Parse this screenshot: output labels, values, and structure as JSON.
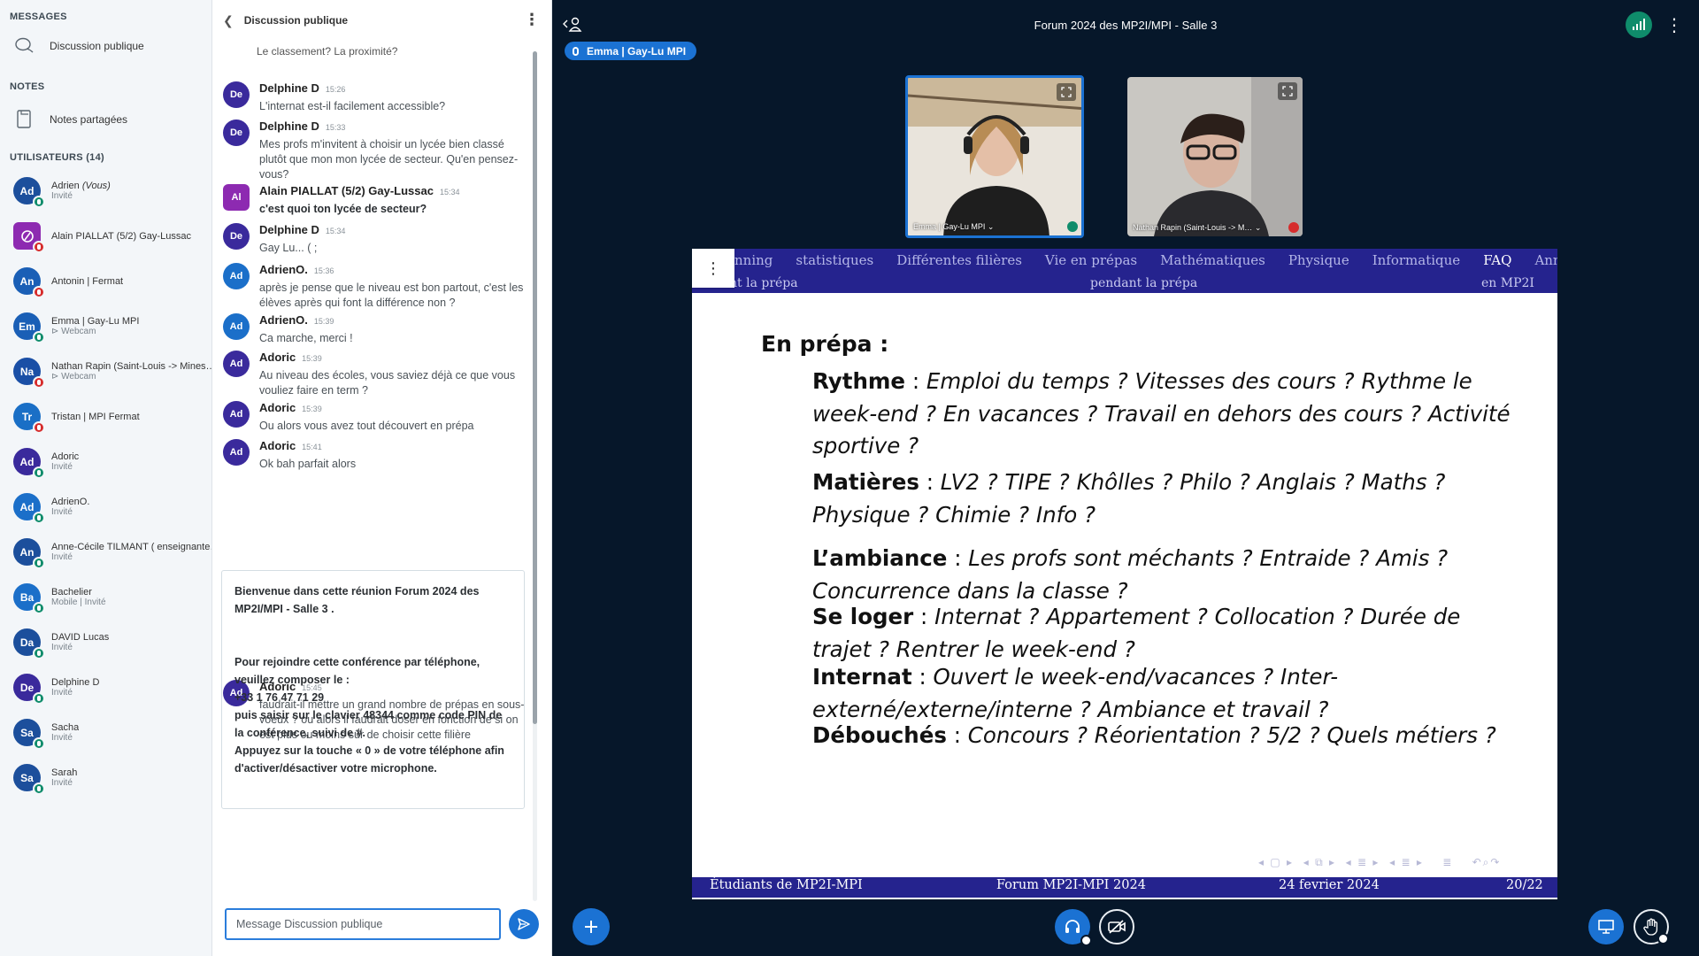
{
  "sidebar": {
    "messages_title": "MESSAGES",
    "public_chat": "Discussion publique",
    "notes_title": "NOTES",
    "shared_notes": "Notes partagées",
    "users_title": "UTILISATEURS (14)",
    "users": [
      {
        "initials": "Ad",
        "name": "Adrien",
        "you": "(Vous)",
        "sub": "Invité",
        "color": "#1c4f9c",
        "status": "green"
      },
      {
        "initials": "",
        "name": "Alain PIALLAT (5/2) Gay-Lussac",
        "you": "",
        "sub": "",
        "color": "#8d2ab1",
        "status": "red"
      },
      {
        "initials": "An",
        "name": "Antonin | Fermat",
        "you": "",
        "sub": "",
        "color": "#1a5fb6",
        "status": "red"
      },
      {
        "initials": "Em",
        "name": "Emma | Gay-Lu MPI",
        "you": "",
        "sub": "⊳ Webcam",
        "color": "#1a5fb6",
        "status": "green"
      },
      {
        "initials": "Na",
        "name": "Nathan Rapin (Saint-Louis -> Mines…",
        "you": "",
        "sub": "⊳ Webcam",
        "color": "#1a4fa6",
        "status": "red"
      },
      {
        "initials": "Tr",
        "name": "Tristan | MPI Fermat",
        "you": "",
        "sub": "",
        "color": "#1a6fc6",
        "status": "red"
      },
      {
        "initials": "Ad",
        "name": "Adoric",
        "you": "",
        "sub": "Invité",
        "color": "#3a2a9c",
        "status": "green"
      },
      {
        "initials": "Ad",
        "name": "AdrienO.",
        "you": "",
        "sub": "Invité",
        "color": "#1b6fc9",
        "status": "green"
      },
      {
        "initials": "An",
        "name": "Anne-Cécile TILMANT ( enseignante…",
        "you": "",
        "sub": "Invité",
        "color": "#1c4f9c",
        "status": "green"
      },
      {
        "initials": "Ba",
        "name": "Bachelier",
        "you": "",
        "sub": "Mobile | Invité",
        "color": "#1b6fc9",
        "status": "green"
      },
      {
        "initials": "Da",
        "name": "DAVID Lucas",
        "you": "",
        "sub": "Invité",
        "color": "#1c4f9c",
        "status": "green"
      },
      {
        "initials": "De",
        "name": "Delphine D",
        "you": "",
        "sub": "Invité",
        "color": "#3a2a9c",
        "status": "green"
      },
      {
        "initials": "Sa",
        "name": "Sacha",
        "you": "",
        "sub": "Invité",
        "color": "#1c4f9c",
        "status": "green"
      },
      {
        "initials": "Sa",
        "name": "Sarah",
        "you": "",
        "sub": "Invité",
        "color": "#1c4f9c",
        "status": "green"
      }
    ]
  },
  "chat": {
    "title": "Discussion publique",
    "truncated_top": "Comment choisir au mieux son établissement selon vous? Le classement? La proximité?",
    "messages": [
      {
        "initials": "De",
        "color": "#3a2a9c",
        "author": "Delphine D",
        "time": "15:26",
        "text": "L'internat est-il facilement accessible?",
        "bold": false
      },
      {
        "initials": "De",
        "color": "#3a2a9c",
        "author": "Delphine D",
        "time": "15:33",
        "text": "Mes profs m'invitent à choisir un lycée bien classé plutôt que mon mon lycée de secteur. Qu'en pensez-vous?",
        "bold": false
      },
      {
        "initials": "Al",
        "color": "#8d2ab1",
        "author": "Alain PIALLAT (5/2) Gay-Lussac",
        "time": "15:34",
        "text": "c'est quoi ton lycée de secteur?",
        "bold": true
      },
      {
        "initials": "De",
        "color": "#3a2a9c",
        "author": "Delphine D",
        "time": "15:34",
        "text": "Gay Lu... ( ;",
        "bold": false
      },
      {
        "initials": "Ad",
        "color": "#1b6fc9",
        "author": "AdrienO.",
        "time": "15:36",
        "text": "après je pense que le niveau est bon partout, c'est les élèves après qui font la différence non ?",
        "bold": false
      },
      {
        "initials": "Ad",
        "color": "#1b6fc9",
        "author": "AdrienO.",
        "time": "15:39",
        "text": "Ca marche, merci !",
        "bold": false
      },
      {
        "initials": "Ad",
        "color": "#3a2a9c",
        "author": "Adoric",
        "time": "15:39",
        "text": "Au niveau des écoles, vous saviez déjà ce que vous vouliez faire en term ?",
        "bold": false
      },
      {
        "initials": "Ad",
        "color": "#3a2a9c",
        "author": "Adoric",
        "time": "15:39",
        "text": "Ou alors vous avez tout découvert en prépa",
        "bold": false
      },
      {
        "initials": "Ad",
        "color": "#3a2a9c",
        "author": "Adoric",
        "time": "15:41",
        "text": "Ok bah parfait alors",
        "bold": false
      },
      {
        "initials": "Ad",
        "color": "#3a2a9c",
        "author": "Adoric",
        "time": "15:45",
        "text": "faudrait-il mettre un grand nombre de prépas en sous-voeux ? ou alors il faudrait doser en fonction de si on est plus ou moins sûr de choisir cette filière",
        "bold": false
      }
    ],
    "welcome": {
      "line1": "Bienvenue dans cette réunion Forum 2024 des MP2I/MPI - Salle 3 .",
      "line2": "Pour rejoindre cette conférence par téléphone, veuillez composer le :",
      "phone": "+33 1 76 47 71 29",
      "line3": "puis saisir sur le clavier 48344 comme code PIN de la conférence, suivi de #.",
      "line4": "Appuyez sur la touche « 0 » de votre téléphone afin d'activer/désactiver votre microphone."
    },
    "input_placeholder": "Message Discussion publique"
  },
  "meeting": {
    "title": "Forum 2024 des MP2I/MPI - Salle 3",
    "talking": "Emma | Gay-Lu MPI",
    "videos": [
      {
        "label": "Emma | Gay-Lu MPI ⌄"
      },
      {
        "label": "Nathan Rapin (Saint-Louis -> M… ⌄"
      }
    ]
  },
  "slide": {
    "nav_top": [
      "nning",
      "statistiques",
      "Différentes filières",
      "Vie en prépas",
      "Mathématiques",
      "Physique",
      "Informatique",
      "FAQ",
      "Annexe"
    ],
    "nav_active": "FAQ",
    "nav_sub_left": "nt la prépa",
    "nav_sub_center": "pendant la prépa",
    "nav_sub_right": "en MP2I",
    "heading": "En prépa :",
    "items": [
      {
        "term": "Rythme",
        "text": "Emploi du temps ? Vitesses des cours ? Rythme le week-end ? En vacances ? Travail en dehors des cours ? Activité sportive ?"
      },
      {
        "term": "Matières",
        "text": "LV2 ? TIPE ? Khôlles ? Philo ? Anglais ? Maths ? Physique ? Chimie ? Info ?"
      },
      {
        "term": "L’ambiance",
        "text": "Les profs sont méchants ? Entraide ? Amis ? Concurrence dans la classe ?"
      },
      {
        "term": "Se loger",
        "text": "Internat ? Appartement ? Collocation ? Durée de trajet ? Rentrer le week-end ?"
      },
      {
        "term": "Internat",
        "text": "Ouvert le week-end/vacances ? Inter-externé/externe/interne ? Ambiance et travail ?"
      },
      {
        "term": "Débouchés",
        "text": "Concours ? Réorientation ? 5/2 ? Quels métiers ?"
      }
    ],
    "footer": {
      "left": "Étudiants de MP2I-MPI",
      "center": "Forum MP2I-MPI 2024",
      "date": "24 fevrier 2024",
      "page": "20/22"
    }
  },
  "colors": {
    "accent": "#1b72d3",
    "slide_bar": "#25238e",
    "bg": "#06172a",
    "green": "#0f8c6b",
    "red": "#d62c2c"
  }
}
